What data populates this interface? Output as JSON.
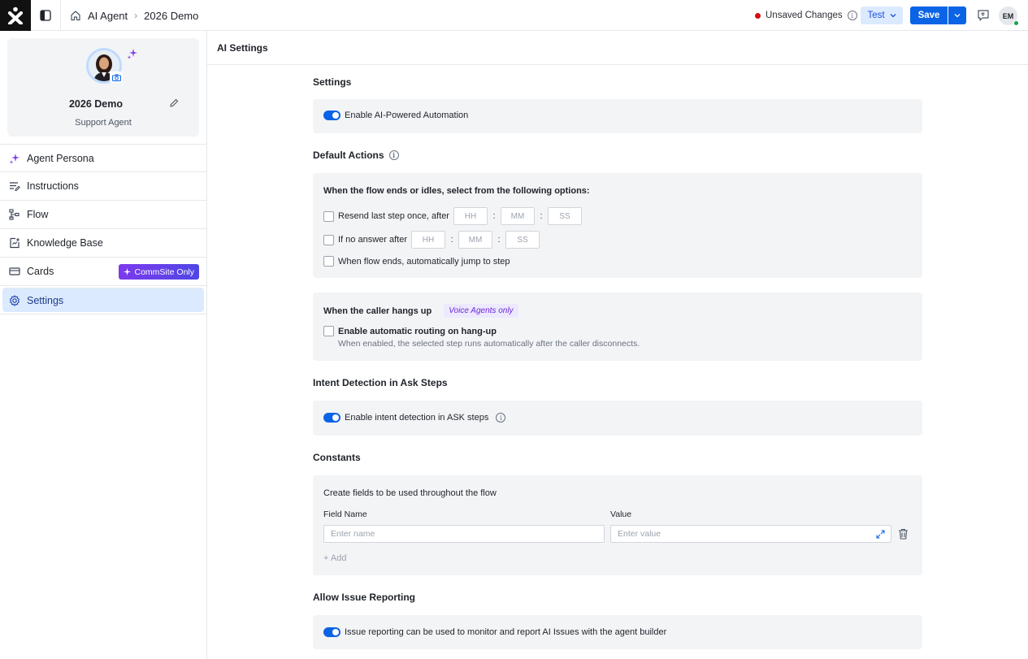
{
  "topbar": {
    "breadcrumb": [
      "AI Agent",
      "2026 Demo"
    ],
    "unsaved_label": "Unsaved Changes",
    "test_label": "Test",
    "save_label": "Save",
    "user_initials": "EM",
    "colors": {
      "primary": "#0b63e5",
      "unsaved_dot": "#d20f0f"
    }
  },
  "profile": {
    "name": "2026 Demo",
    "role": "Support Agent"
  },
  "sidebar": {
    "items": [
      {
        "label": "Agent Persona",
        "icon": "sparkle-icon"
      },
      {
        "label": "Instructions",
        "icon": "instructions-icon"
      },
      {
        "label": "Flow",
        "icon": "flow-icon"
      },
      {
        "label": "Knowledge Base",
        "icon": "knowledge-base-icon"
      },
      {
        "label": "Cards",
        "icon": "cards-icon",
        "badge": "CommSite Only"
      },
      {
        "label": "Settings",
        "icon": "gear-icon",
        "active": true
      }
    ]
  },
  "main": {
    "title": "AI Settings",
    "settings": {
      "title": "Settings",
      "toggle_label": "Enable AI-Powered Automation"
    },
    "default_actions": {
      "title": "Default Actions",
      "heading": "When the flow ends or idles, select from the following options:",
      "resend_label": "Resend last step once, after",
      "no_answer_label": "If no answer after",
      "jump_label": "When flow ends, automatically jump to step",
      "hh": "HH",
      "mm": "MM",
      "ss": "SS"
    },
    "hangup": {
      "title": "When the caller hangs up",
      "badge": "Voice Agents only",
      "checkbox_label": "Enable automatic routing on hang-up",
      "description": "When enabled, the selected step runs automatically after the caller disconnects."
    },
    "intent": {
      "title": "Intent Detection in Ask Steps",
      "toggle_label": "Enable intent detection in ASK steps"
    },
    "constants": {
      "title": "Constants",
      "description": "Create fields to be used throughout the flow",
      "field_name_label": "Field Name",
      "value_label": "Value",
      "name_placeholder": "Enter name",
      "value_placeholder": "Enter value",
      "add_label": "+ Add"
    },
    "issue_reporting": {
      "title": "Allow Issue Reporting",
      "toggle_label": "Issue reporting can be used to monitor and report AI Issues with the agent builder"
    }
  }
}
